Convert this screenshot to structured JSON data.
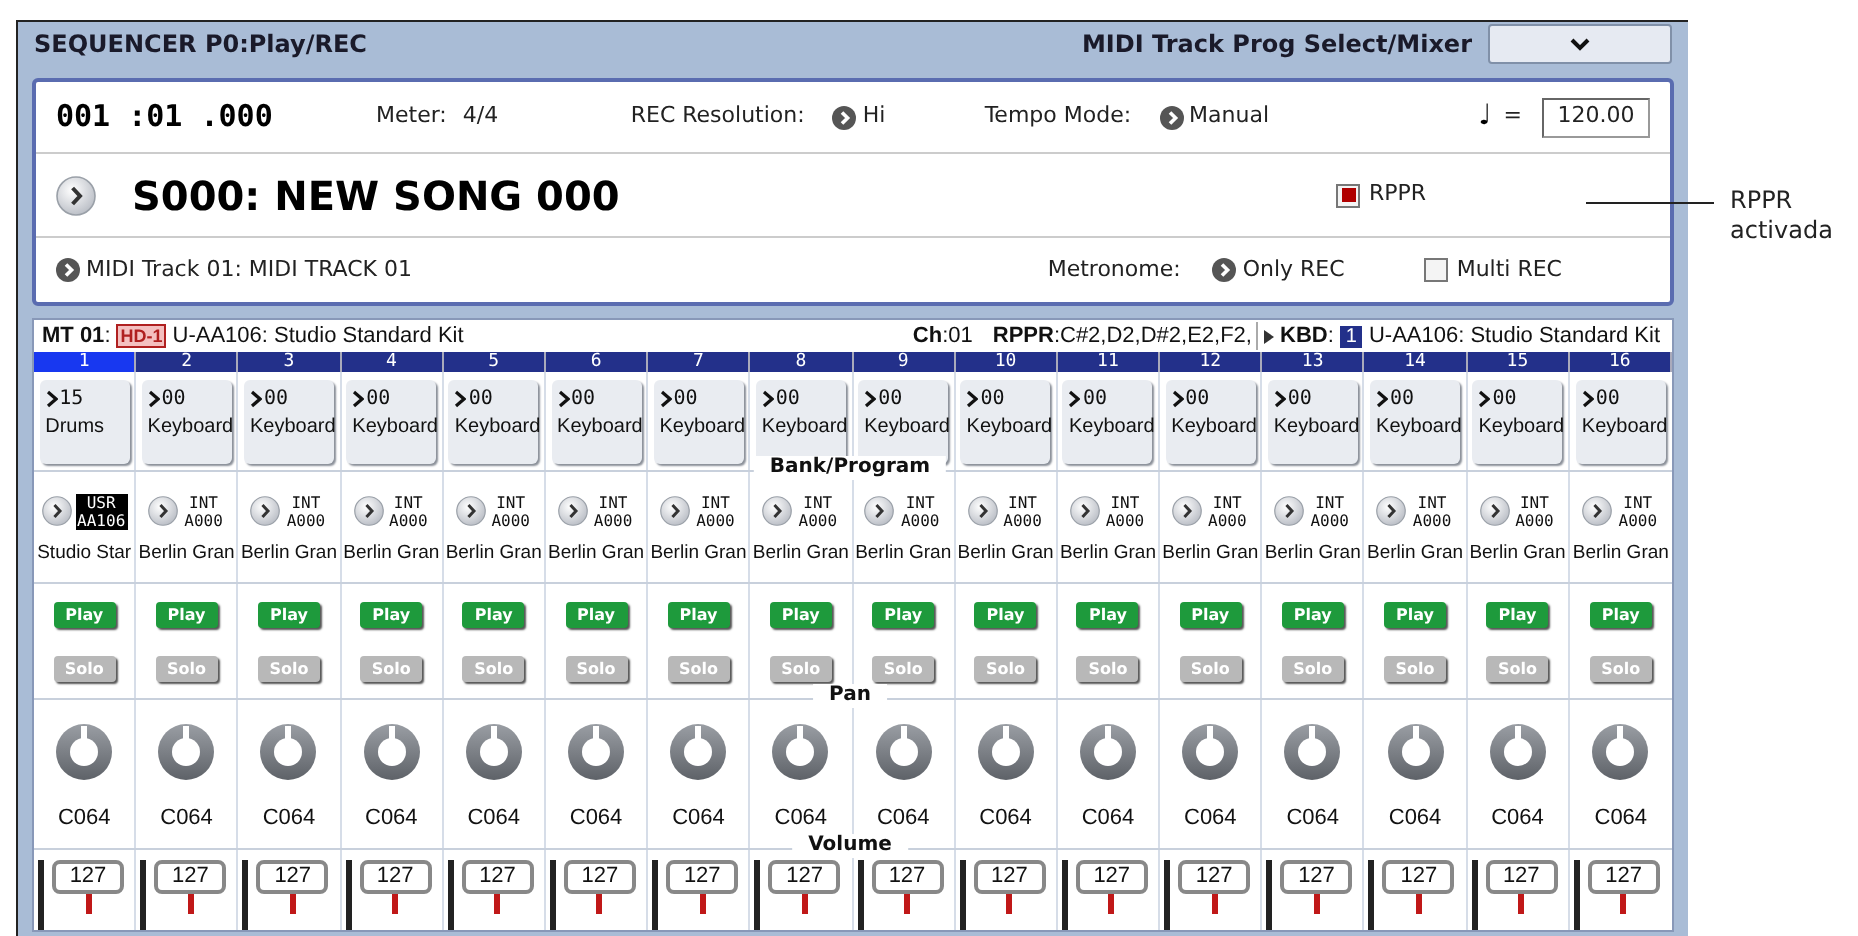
{
  "window": {
    "title": "SEQUENCER P0:Play/REC",
    "page": "MIDI Track Prog Select/Mixer"
  },
  "transport": {
    "location": "001 :01 .000",
    "meter_label": "Meter:",
    "meter": "4/4",
    "rec_resolution_label": "REC Resolution:",
    "rec_resolution": "Hi",
    "tempo_mode_label": "Tempo Mode:",
    "tempo_mode": "Manual",
    "tempo_symbol": "♩",
    "tempo_equals": "=",
    "tempo": "120.00"
  },
  "song": {
    "name": "S000: NEW SONG 000",
    "rppr": {
      "label": "RPPR",
      "checked": true
    }
  },
  "track_select": {
    "track": "MIDI Track 01: MIDI TRACK 01",
    "metronome_label": "Metronome:",
    "metronome": "Only REC",
    "multi_rec": {
      "label": "Multi REC",
      "checked": false
    }
  },
  "info_bar": {
    "track": "**MT 01**:",
    "badge": "HD-1",
    "program": "U-AA106: Studio Standard Kit",
    "channel": "**Ch**:01",
    "rppr": "**RPPR**:C#2,D2,D#2,E2,F2,",
    "kbd_label": "**KBD**:",
    "kbd_track": "1",
    "kbd_program": "U-AA106: Studio Standard Kit"
  },
  "section_labels": [
    "Bank/Program",
    "Pan",
    "Volume"
  ],
  "tracks": [
    {
      "number": "1",
      "selected": true,
      "category_number": "15",
      "category": "Drums",
      "bank": "USR",
      "program": "AA106",
      "bank_selected": true,
      "program_name": "Studio Star",
      "play": {
        "label": "Play",
        "on": true
      },
      "solo": {
        "label": "Solo",
        "on": false
      },
      "pan": "C064",
      "volume": "127"
    },
    {
      "number": "2",
      "selected": false,
      "category_number": "00",
      "category": "Keyboard",
      "bank": "INT",
      "program": "A000",
      "bank_selected": false,
      "program_name": "Berlin Gran",
      "play": {
        "label": "Play",
        "on": true
      },
      "solo": {
        "label": "Solo",
        "on": false
      },
      "pan": "C064",
      "volume": "127"
    },
    {
      "number": "3",
      "selected": false,
      "category_number": "00",
      "category": "Keyboard",
      "bank": "INT",
      "program": "A000",
      "bank_selected": false,
      "program_name": "Berlin Gran",
      "play": {
        "label": "Play",
        "on": true
      },
      "solo": {
        "label": "Solo",
        "on": false
      },
      "pan": "C064",
      "volume": "127"
    },
    {
      "number": "4",
      "selected": false,
      "category_number": "00",
      "category": "Keyboard",
      "bank": "INT",
      "program": "A000",
      "bank_selected": false,
      "program_name": "Berlin Gran",
      "play": {
        "label": "Play",
        "on": true
      },
      "solo": {
        "label": "Solo",
        "on": false
      },
      "pan": "C064",
      "volume": "127"
    },
    {
      "number": "5",
      "selected": false,
      "category_number": "00",
      "category": "Keyboard",
      "bank": "INT",
      "program": "A000",
      "bank_selected": false,
      "program_name": "Berlin Gran",
      "play": {
        "label": "Play",
        "on": true
      },
      "solo": {
        "label": "Solo",
        "on": false
      },
      "pan": "C064",
      "volume": "127"
    },
    {
      "number": "6",
      "selected": false,
      "category_number": "00",
      "category": "Keyboard",
      "bank": "INT",
      "program": "A000",
      "bank_selected": false,
      "program_name": "Berlin Gran",
      "play": {
        "label": "Play",
        "on": true
      },
      "solo": {
        "label": "Solo",
        "on": false
      },
      "pan": "C064",
      "volume": "127"
    },
    {
      "number": "7",
      "selected": false,
      "category_number": "00",
      "category": "Keyboard",
      "bank": "INT",
      "program": "A000",
      "bank_selected": false,
      "program_name": "Berlin Gran",
      "play": {
        "label": "Play",
        "on": true
      },
      "solo": {
        "label": "Solo",
        "on": false
      },
      "pan": "C064",
      "volume": "127"
    },
    {
      "number": "8",
      "selected": false,
      "category_number": "00",
      "category": "Keyboard",
      "bank": "INT",
      "program": "A000",
      "bank_selected": false,
      "program_name": "Berlin Gran",
      "play": {
        "label": "Play",
        "on": true
      },
      "solo": {
        "label": "Solo",
        "on": false
      },
      "pan": "C064",
      "volume": "127"
    },
    {
      "number": "9",
      "selected": false,
      "category_number": "00",
      "category": "Keyboard",
      "bank": "INT",
      "program": "A000",
      "bank_selected": false,
      "program_name": "Berlin Gran",
      "play": {
        "label": "Play",
        "on": true
      },
      "solo": {
        "label": "Solo",
        "on": false
      },
      "pan": "C064",
      "volume": "127"
    },
    {
      "number": "10",
      "selected": false,
      "category_number": "00",
      "category": "Keyboard",
      "bank": "INT",
      "program": "A000",
      "bank_selected": false,
      "program_name": "Berlin Gran",
      "play": {
        "label": "Play",
        "on": true
      },
      "solo": {
        "label": "Solo",
        "on": false
      },
      "pan": "C064",
      "volume": "127"
    },
    {
      "number": "11",
      "selected": false,
      "category_number": "00",
      "category": "Keyboard",
      "bank": "INT",
      "program": "A000",
      "bank_selected": false,
      "program_name": "Berlin Gran",
      "play": {
        "label": "Play",
        "on": true
      },
      "solo": {
        "label": "Solo",
        "on": false
      },
      "pan": "C064",
      "volume": "127"
    },
    {
      "number": "12",
      "selected": false,
      "category_number": "00",
      "category": "Keyboard",
      "bank": "INT",
      "program": "A000",
      "bank_selected": false,
      "program_name": "Berlin Gran",
      "play": {
        "label": "Play",
        "on": true
      },
      "solo": {
        "label": "Solo",
        "on": false
      },
      "pan": "C064",
      "volume": "127"
    },
    {
      "number": "13",
      "selected": false,
      "category_number": "00",
      "category": "Keyboard",
      "bank": "INT",
      "program": "A000",
      "bank_selected": false,
      "program_name": "Berlin Gran",
      "play": {
        "label": "Play",
        "on": true
      },
      "solo": {
        "label": "Solo",
        "on": false
      },
      "pan": "C064",
      "volume": "127"
    },
    {
      "number": "14",
      "selected": false,
      "category_number": "00",
      "category": "Keyboard",
      "bank": "INT",
      "program": "A000",
      "bank_selected": false,
      "program_name": "Berlin Gran",
      "play": {
        "label": "Play",
        "on": true
      },
      "solo": {
        "label": "Solo",
        "on": false
      },
      "pan": "C064",
      "volume": "127"
    },
    {
      "number": "15",
      "selected": false,
      "category_number": "00",
      "category": "Keyboard",
      "bank": "INT",
      "program": "A000",
      "bank_selected": false,
      "program_name": "Berlin Gran",
      "play": {
        "label": "Play",
        "on": true
      },
      "solo": {
        "label": "Solo",
        "on": false
      },
      "pan": "C064",
      "volume": "127"
    },
    {
      "number": "16",
      "selected": false,
      "category_number": "00",
      "category": "Keyboard",
      "bank": "INT",
      "program": "A000",
      "bank_selected": false,
      "program_name": "Berlin Gran",
      "play": {
        "label": "Play",
        "on": true
      },
      "solo": {
        "label": "Solo",
        "on": false
      },
      "pan": "C064",
      "volume": "127"
    }
  ],
  "annotation": "RPPR activada"
}
